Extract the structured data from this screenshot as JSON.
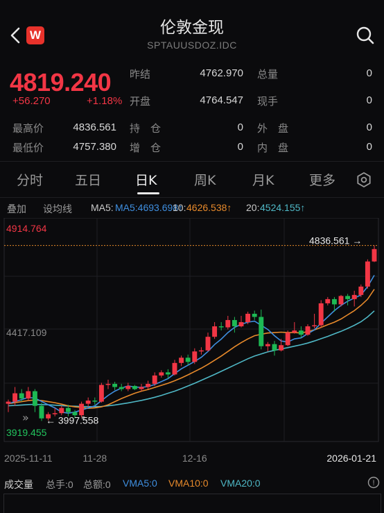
{
  "header": {
    "title": "伦敦金现",
    "subtitle": "SPTAUUSDOZ.IDC",
    "logo_text": "W"
  },
  "quote": {
    "price": "4819.240",
    "change": "+56.270",
    "change_pct": "+1.18%",
    "prev_close_label": "昨结",
    "prev_close": "4762.970",
    "open_label": "开盘",
    "open": "4764.547",
    "volume_label": "总量",
    "volume": "0",
    "current_hand_label": "现手",
    "current_hand": "0",
    "high_label": "最高价",
    "high": "4836.561",
    "low_label": "最低价",
    "low": "4757.380",
    "position_label": "持　仓",
    "position": "0",
    "increase_label": "增　仓",
    "increase": "0",
    "outer_label": "外　盘",
    "outer": "0",
    "inner_label": "内　盘",
    "inner": "0"
  },
  "tabs": [
    "分时",
    "五日",
    "日K",
    "周K",
    "月K",
    "更多"
  ],
  "active_tab": "日K",
  "indicators": {
    "overlay": "叠加",
    "set_line": "设均线",
    "ma5": "MA5:4693.698↑",
    "ma10_label": "10:",
    "ma10": "4626.538↑",
    "ma20_label": "20:",
    "ma20": "4524.155↑"
  },
  "volume_bar": {
    "label": "成交量",
    "total_hand": "总手:0",
    "total_amount": "总额:0",
    "vma5": "VMA5:0",
    "vma10": "VMA10:0",
    "vma20": "VMA20:0"
  },
  "colors": {
    "up": "#f23645",
    "down": "#1db954",
    "ma5": "#3f8fe0",
    "ma10": "#e88a2b",
    "ma20": "#4fb8c6",
    "high_label": "#f23645",
    "low_label": "#22c55e"
  },
  "chart_data": {
    "type": "candlestick",
    "y_axis_labels": [
      "4914.764",
      "4417.109",
      "3919.455"
    ],
    "ylim": [
      3919.455,
      4914.764
    ],
    "x_labels": [
      {
        "label": "2025-11-11",
        "index": 0
      },
      {
        "label": "11-28",
        "index": 13
      },
      {
        "label": "12-16",
        "index": 28
      },
      {
        "label": "2026-01-21",
        "index": 52
      }
    ],
    "max_marker": {
      "label": "4836.561",
      "value": 4836.561
    },
    "min_marker": {
      "label": "3997.558",
      "value": 3997.558
    },
    "candles": [
      [
        4080,
        4090,
        4040,
        4100
      ],
      [
        4090,
        4130,
        4070,
        4160
      ],
      [
        4130,
        4105,
        4090,
        4150
      ],
      [
        4105,
        4140,
        4095,
        4160
      ],
      [
        4140,
        4070,
        4040,
        4150
      ],
      [
        4070,
        4010,
        3998,
        4085
      ],
      [
        4010,
        4030,
        4000,
        4040
      ],
      [
        4030,
        4035,
        4020,
        4060
      ],
      [
        4035,
        4060,
        4025,
        4070
      ],
      [
        4060,
        4040,
        4020,
        4075
      ],
      [
        4040,
        4025,
        4010,
        4050
      ],
      [
        4025,
        4080,
        4015,
        4090
      ],
      [
        4080,
        4095,
        4065,
        4110
      ],
      [
        4095,
        4090,
        4075,
        4110
      ],
      [
        4090,
        4170,
        4085,
        4180
      ],
      [
        4170,
        4175,
        4150,
        4195
      ],
      [
        4175,
        4160,
        4145,
        4185
      ],
      [
        4160,
        4150,
        4140,
        4175
      ],
      [
        4150,
        4165,
        4140,
        4180
      ],
      [
        4165,
        4150,
        4145,
        4170
      ],
      [
        4150,
        4160,
        4140,
        4175
      ],
      [
        4160,
        4175,
        4150,
        4190
      ],
      [
        4175,
        4215,
        4165,
        4230
      ],
      [
        4215,
        4230,
        4205,
        4240
      ],
      [
        4230,
        4220,
        4200,
        4245
      ],
      [
        4220,
        4275,
        4215,
        4290
      ],
      [
        4275,
        4300,
        4260,
        4310
      ],
      [
        4300,
        4280,
        4265,
        4315
      ],
      [
        4280,
        4330,
        4270,
        4345
      ],
      [
        4330,
        4335,
        4315,
        4350
      ],
      [
        4335,
        4400,
        4330,
        4420
      ],
      [
        4400,
        4450,
        4390,
        4470
      ],
      [
        4450,
        4445,
        4430,
        4470
      ],
      [
        4445,
        4480,
        4435,
        4500
      ],
      [
        4480,
        4450,
        4420,
        4495
      ],
      [
        4450,
        4470,
        4445,
        4500
      ],
      [
        4470,
        4510,
        4460,
        4520
      ],
      [
        4510,
        4495,
        4480,
        4525
      ],
      [
        4495,
        4355,
        4340,
        4530
      ],
      [
        4355,
        4365,
        4330,
        4375
      ],
      [
        4365,
        4335,
        4310,
        4380
      ],
      [
        4335,
        4360,
        4330,
        4390
      ],
      [
        4360,
        4420,
        4355,
        4430
      ],
      [
        4420,
        4430,
        4415,
        4470
      ],
      [
        4430,
        4410,
        4395,
        4450
      ],
      [
        4410,
        4450,
        4405,
        4460
      ],
      [
        4450,
        4455,
        4440,
        4510
      ],
      [
        4455,
        4560,
        4445,
        4575
      ],
      [
        4560,
        4580,
        4550,
        4590
      ],
      [
        4580,
        4555,
        4520,
        4590
      ],
      [
        4555,
        4595,
        4545,
        4600
      ],
      [
        4595,
        4580,
        4550,
        4605
      ],
      [
        4580,
        4600,
        4545,
        4620
      ],
      [
        4600,
        4640,
        4590,
        4650
      ],
      [
        4640,
        4760,
        4630,
        4770
      ],
      [
        4760,
        4819.24,
        4757.38,
        4836.561
      ]
    ],
    "ma5": [
      4080,
      4090,
      4100,
      4110,
      4107,
      4091,
      4075,
      4060,
      4040,
      4035,
      4040,
      4050,
      4060,
      4070,
      4095,
      4120,
      4140,
      4155,
      4165,
      4160,
      4158,
      4162,
      4172,
      4186,
      4200,
      4224,
      4247,
      4264,
      4282,
      4302,
      4330,
      4363,
      4389,
      4420,
      4445,
      4460,
      4470,
      4475,
      4455,
      4435,
      4405,
      4380,
      4375,
      4390,
      4395,
      4415,
      4433,
      4465,
      4495,
      4525,
      4550,
      4570,
      4585,
      4600,
      4640,
      4694
    ],
    "ma10": [
      4080,
      4085,
      4090,
      4095,
      4098,
      4095,
      4090,
      4085,
      4078,
      4070,
      4065,
      4062,
      4058,
      4060,
      4065,
      4075,
      4090,
      4105,
      4118,
      4130,
      4140,
      4148,
      4158,
      4168,
      4178,
      4190,
      4203,
      4218,
      4234,
      4250,
      4268,
      4288,
      4308,
      4330,
      4352,
      4372,
      4390,
      4405,
      4412,
      4418,
      4420,
      4422,
      4420,
      4420,
      4418,
      4425,
      4433,
      4445,
      4458,
      4470,
      4485,
      4505,
      4525,
      4550,
      4580,
      4627
    ],
    "ma20": [
      4070,
      4072,
      4074,
      4076,
      4077,
      4076,
      4075,
      4073,
      4071,
      4069,
      4068,
      4067,
      4066,
      4066,
      4067,
      4070,
      4074,
      4079,
      4084,
      4090,
      4096,
      4103,
      4111,
      4120,
      4130,
      4140,
      4152,
      4165,
      4178,
      4192,
      4206,
      4220,
      4235,
      4250,
      4265,
      4280,
      4295,
      4308,
      4318,
      4328,
      4335,
      4342,
      4348,
      4355,
      4362,
      4370,
      4380,
      4391,
      4402,
      4414,
      4426,
      4440,
      4455,
      4472,
      4495,
      4524
    ]
  }
}
